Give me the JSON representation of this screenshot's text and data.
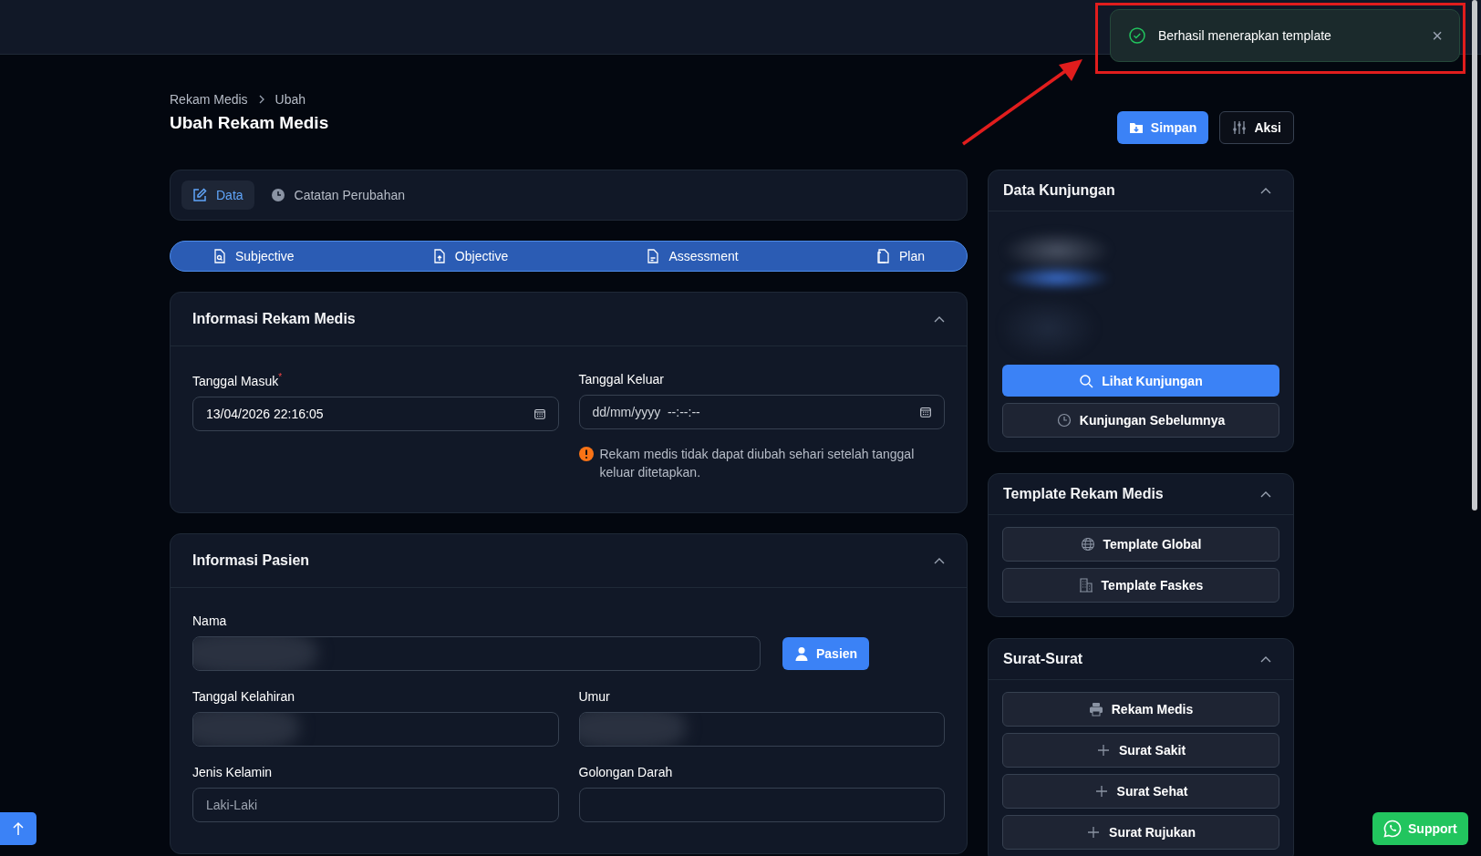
{
  "toast": {
    "message": "Berhasil menerapkan template",
    "close": "×"
  },
  "breadcrumb": [
    {
      "label": "Rekam Medis"
    },
    {
      "label": "Ubah"
    }
  ],
  "page_title": "Ubah Rekam Medis",
  "header_actions": [
    {
      "label": "Simpan",
      "kind": "primary"
    },
    {
      "label": "Aksi",
      "kind": "outline"
    }
  ],
  "tabs": [
    {
      "label": "Data",
      "selected": true
    },
    {
      "label": "Catatan Perubahan",
      "selected": false
    }
  ],
  "soap_steps": [
    {
      "label": "Subjective"
    },
    {
      "label": "Objective"
    },
    {
      "label": "Assessment"
    },
    {
      "label": "Plan"
    }
  ],
  "rekam_medis_card": {
    "title": "Informasi Rekam Medis",
    "expanded": true,
    "fields": [
      {
        "label": "Tanggal Masuk",
        "required_mark": "*",
        "value": "13/04/2026 22:16:05"
      },
      {
        "label": "Tanggal Keluar",
        "placeholder": "dd/mm/yyyy  --:--:--"
      }
    ],
    "warning": "Rekam medis tidak dapat diubah sehari setelah tanggal keluar ditetapkan."
  },
  "pasien_card": {
    "title": "Informasi Pasien",
    "expanded": true,
    "name_field": {
      "label": "Nama",
      "redacted": true
    },
    "patient_button": "Pasien",
    "fields": [
      {
        "label": "Tanggal Kelahiran",
        "redacted": true
      },
      {
        "label": "Umur",
        "redacted": true
      },
      {
        "label": "Jenis Kelamin",
        "redacted": false,
        "placeholder": "Laki-Laki"
      },
      {
        "label": "Golongan Darah",
        "redacted": false
      }
    ]
  },
  "side_cards": [
    {
      "title": "Data Kunjungan",
      "expanded": true,
      "redacted": true,
      "buttons": [
        {
          "label": "Lihat Kunjungan",
          "kind": "primary"
        },
        {
          "label": "Kunjungan Sebelumnya",
          "kind": "outline"
        }
      ]
    },
    {
      "title": "Template Rekam Medis",
      "expanded": true,
      "redacted": false,
      "buttons": [
        {
          "label": "Template Global",
          "kind": "outline"
        },
        {
          "label": "Template Faskes",
          "kind": "outline"
        }
      ]
    },
    {
      "title": "Surat-Surat",
      "expanded": true,
      "redacted": false,
      "buttons": [
        {
          "label": "Rekam Medis",
          "kind": "outline"
        },
        {
          "label": "Surat Sakit",
          "kind": "outline"
        },
        {
          "label": "Surat Sehat",
          "kind": "outline"
        },
        {
          "label": "Surat Rujukan",
          "kind": "outline"
        }
      ]
    }
  ],
  "support_button": "Support"
}
